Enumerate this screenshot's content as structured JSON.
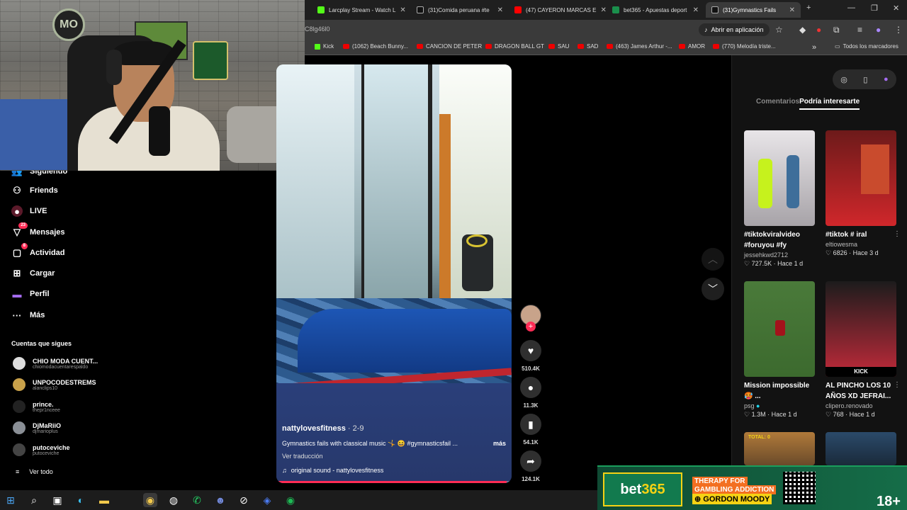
{
  "browser": {
    "tabs": [
      {
        "label": "Larcplay Stream - Watch L",
        "icon_color": "#53fc18"
      },
      {
        "label": "(31)Comida peruana #te",
        "icon_color": "#ffffff"
      },
      {
        "label": "(47) CAYERON MARCAS E",
        "icon_color": "#ff0000"
      },
      {
        "label": "bet365 - Apuestas deport",
        "icon_color": "#1a8f4c"
      },
      {
        "label": "(31)Gymnastics Fails",
        "icon_color": "#ffffff"
      }
    ],
    "new_tab": "+",
    "url_fragment": "C8lg46l0",
    "open_app_label": "Abrir en aplicación",
    "bookmarks": [
      {
        "label": "Kick",
        "kind": "kick"
      },
      {
        "label": "(1062) Beach Bunny...",
        "kind": "youtube"
      },
      {
        "label": "CANCION DE PETER",
        "kind": "youtube"
      },
      {
        "label": "DRAGON BALL GT",
        "kind": "youtube"
      },
      {
        "label": "SAU",
        "kind": "youtube"
      },
      {
        "label": "SAD",
        "kind": "youtube"
      },
      {
        "label": "(463) James Arthur -...",
        "kind": "youtube"
      },
      {
        "label": "AMOR",
        "kind": "youtube"
      },
      {
        "label": "(770) Melodía triste...",
        "kind": "youtube"
      }
    ],
    "more_bookmarks": "»",
    "all_bookmarks": "Todos los marcadores"
  },
  "webcam": {
    "logo_text": "MO"
  },
  "sidebar": {
    "nav": [
      {
        "label": "Siguiendo",
        "icon": "users-icon",
        "badge": ""
      },
      {
        "label": "Friends",
        "icon": "friends-icon",
        "badge": ""
      },
      {
        "label": "LIVE",
        "icon": "live-icon",
        "badge": ""
      },
      {
        "label": "Mensajes",
        "icon": "messages-icon",
        "badge": "23"
      },
      {
        "label": "Actividad",
        "icon": "activity-icon",
        "badge": "8"
      },
      {
        "label": "Cargar",
        "icon": "upload-icon",
        "badge": ""
      },
      {
        "label": "Perfil",
        "icon": "profile-icon",
        "badge": ""
      },
      {
        "label": "Más",
        "icon": "more-icon",
        "badge": ""
      }
    ],
    "following_title": "Cuentas que sigues",
    "following": [
      {
        "name": "CHIO MODA CUENT...",
        "handle": "chiomodacuentarespaldo"
      },
      {
        "name": "UNPOCODESTREMS",
        "handle": "alanclips10"
      },
      {
        "name": "prince.",
        "handle": "thepr1nceee"
      },
      {
        "name": "DjMaRiiO",
        "handle": "djmarioplus"
      },
      {
        "name": "putoceviche",
        "handle": "putoceviche"
      }
    ],
    "see_all": "Ver todo"
  },
  "video": {
    "username": "nattylovesfitness",
    "date": " · 2-9",
    "description": "Gymnastics fails with classical music 🤸 😆 #gymnasticsfail ...",
    "more": "más",
    "translate": "Ver traducción",
    "sound": "original sound - nattylovesfitness",
    "progress": 0.98
  },
  "actions": {
    "likes": "510.4K",
    "comments": "11.3K",
    "saves": "54.1K",
    "shares": "124.1K"
  },
  "right_panel": {
    "tabs": [
      {
        "label": "Comentarios",
        "active": false
      },
      {
        "label": "Podría interesarte",
        "active": true
      }
    ],
    "cards": [
      {
        "title": "#tiktokviralvideo #foruyou #fy",
        "author": "jessehkwd2712",
        "likes": "727.5K",
        "time": "Hace 1 d"
      },
      {
        "title": "#tiktok # iral",
        "author": "eltiowesma",
        "likes": "6826",
        "time": "Hace 3 d"
      },
      {
        "title": "Mission impossible 🥵 ...",
        "author": "psg",
        "likes": "1.3M",
        "time": "Hace 1 d"
      },
      {
        "title": "AL PINCHO LOS 10 AÑOS XD JEFRAI...",
        "author": "clipero.renovado",
        "likes": "768",
        "time": "Hace 1 d"
      }
    ],
    "card_overlay_text": "KICK",
    "partial_thumb_text": "TOTAL: 0"
  },
  "ad": {
    "brand_a": "bet",
    "brand_b": "365",
    "line1": "THERAPY FOR",
    "line2": "GAMBLING ADDICTION",
    "line3": "⊕ GORDON MOODY",
    "age": "18+"
  },
  "taskbar": {
    "icons": [
      "windows-icon",
      "search-icon",
      "store-icon",
      "edge-icon",
      "folder-icon",
      "chrome-icon",
      "obs-icon",
      "whatsapp-icon",
      "discord-icon",
      "steam-icon",
      "ea-icon",
      "spotify-icon"
    ]
  }
}
